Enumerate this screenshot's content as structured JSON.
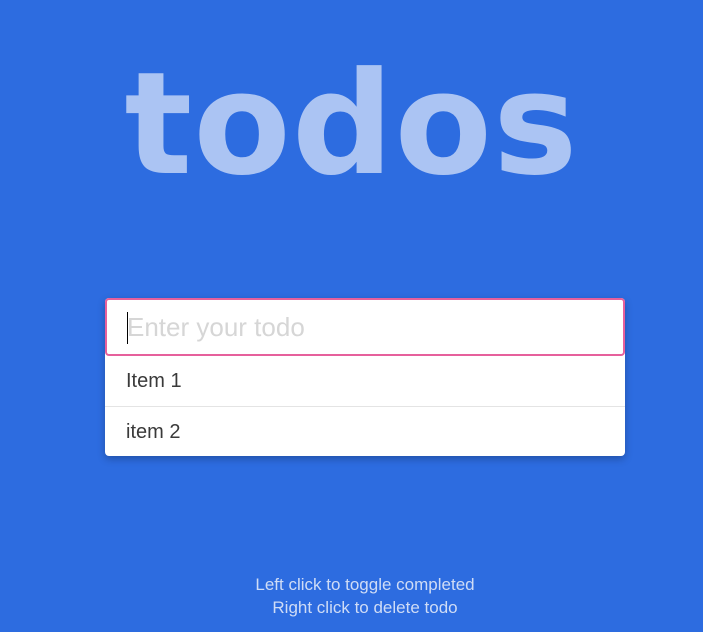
{
  "app": {
    "title": "todos"
  },
  "input": {
    "placeholder": "Enter your todo",
    "value": ""
  },
  "todos": [
    {
      "text": "Item 1",
      "completed": false
    },
    {
      "text": "item 2",
      "completed": false
    }
  ],
  "hints": {
    "left_click": "Left click to toggle completed",
    "right_click": "Right click to delete todo"
  },
  "colors": {
    "background": "#2d6ce0",
    "input_focus_border": "#e6609c",
    "title": "rgba(255,255,255,0.6)"
  }
}
